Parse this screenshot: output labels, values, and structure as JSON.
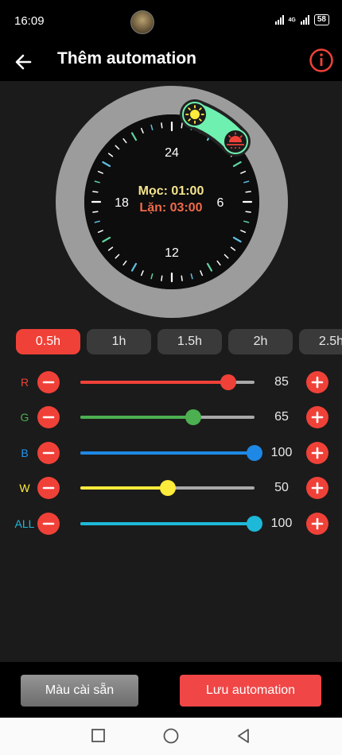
{
  "status": {
    "time": "16:09",
    "network": "4G",
    "battery": "58"
  },
  "header": {
    "title": "Thêm automation"
  },
  "clock": {
    "labels": {
      "top": "24",
      "right": "6",
      "bottom": "12",
      "left": "18"
    },
    "sunrise": "Mọc: 01:00",
    "sunset": "Lặn: 03:00"
  },
  "durations": [
    {
      "label": "0.5h",
      "active": true
    },
    {
      "label": "1h",
      "active": false
    },
    {
      "label": "1.5h",
      "active": false
    },
    {
      "label": "2h",
      "active": false
    },
    {
      "label": "2.5h",
      "active": false
    }
  ],
  "channels": [
    {
      "label": "R",
      "value": "85",
      "level": 0.85,
      "color": "#f04138",
      "label_color": "#f04138"
    },
    {
      "label": "G",
      "value": "65",
      "level": 0.65,
      "color": "#4caf50",
      "label_color": "#4caf50"
    },
    {
      "label": "B",
      "value": "100",
      "level": 1.0,
      "color": "#1e88e5",
      "label_color": "#2196f3"
    },
    {
      "label": "W",
      "value": "50",
      "level": 0.5,
      "color": "#ffeb3b",
      "label_color": "#ffeb3b"
    },
    {
      "label": "ALL",
      "value": "100",
      "level": 1.0,
      "color": "#1eb8d8",
      "label_color": "#1eb8d8"
    }
  ],
  "footer": {
    "preset_label": "Màu cài sẵn",
    "save_label": "Lưu automation"
  }
}
